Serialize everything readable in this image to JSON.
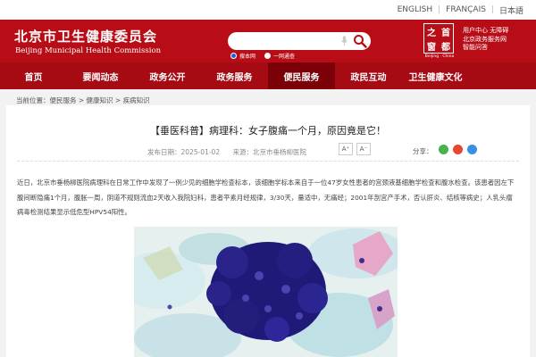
{
  "lang_bar": {
    "items": [
      "ENGLISH",
      "FRANÇAIS",
      "日本語"
    ]
  },
  "header": {
    "title_cn": "北京市卫生健康委员会",
    "title_en": "Beijing Municipal Health Commission",
    "search": {
      "placeholder": "",
      "scope_options": [
        "搜本网",
        "一网通查"
      ],
      "selected_scope": "搜本网"
    },
    "seal": {
      "chars": [
        "之",
        "首",
        "窗",
        "都"
      ],
      "subtitle": "Beijing · China"
    },
    "service_links": [
      "用户中心  无障碍",
      "北京政务服务网",
      "智能问答"
    ]
  },
  "nav": {
    "items": [
      "首页",
      "要闻动态",
      "政务公开",
      "政务服务",
      "便民服务",
      "政民互动",
      "卫生健康文化"
    ],
    "active": "便民服务"
  },
  "breadcrumb": "当前位置：便民服务 > 健康知识 > 疾病知识",
  "article": {
    "title": "【垂医科普】病理科：女子腹痛一个月，原因竟是它！",
    "publish_date": "发布日期：2025-01-02",
    "source": "来源：北京市垂杨柳医院",
    "font_larger": "A⁺",
    "font_smaller": "A⁻",
    "share_label": "分享：",
    "paragraph": "近日，北京市垂杨柳医院病理科在日常工作中发现了一例少见的细胞学检查标本，该细胞学标本来自于一位47岁女性患者的宫颈液基细胞学检查和腹水检查。该患者因左下腹间断隐痛1个月，腹胀一周，阴道不规则流血2天收入我院妇科，患者平素月经规律，3/30天，量适中，无痛经；2001年剖宫产手术，否认肝炎、结核等病史；人乳头瘤病毒检测结果显示低危型HPV54阳性。"
  },
  "colors": {
    "header_red": "#b80d17",
    "nav_red": "#a60a13",
    "nav_active": "#7c0008",
    "radio_selected": "#1e5fd6"
  },
  "icons": [
    "microphone-icon",
    "search-icon",
    "wechat-icon",
    "weibo-icon",
    "qq-icon"
  ]
}
